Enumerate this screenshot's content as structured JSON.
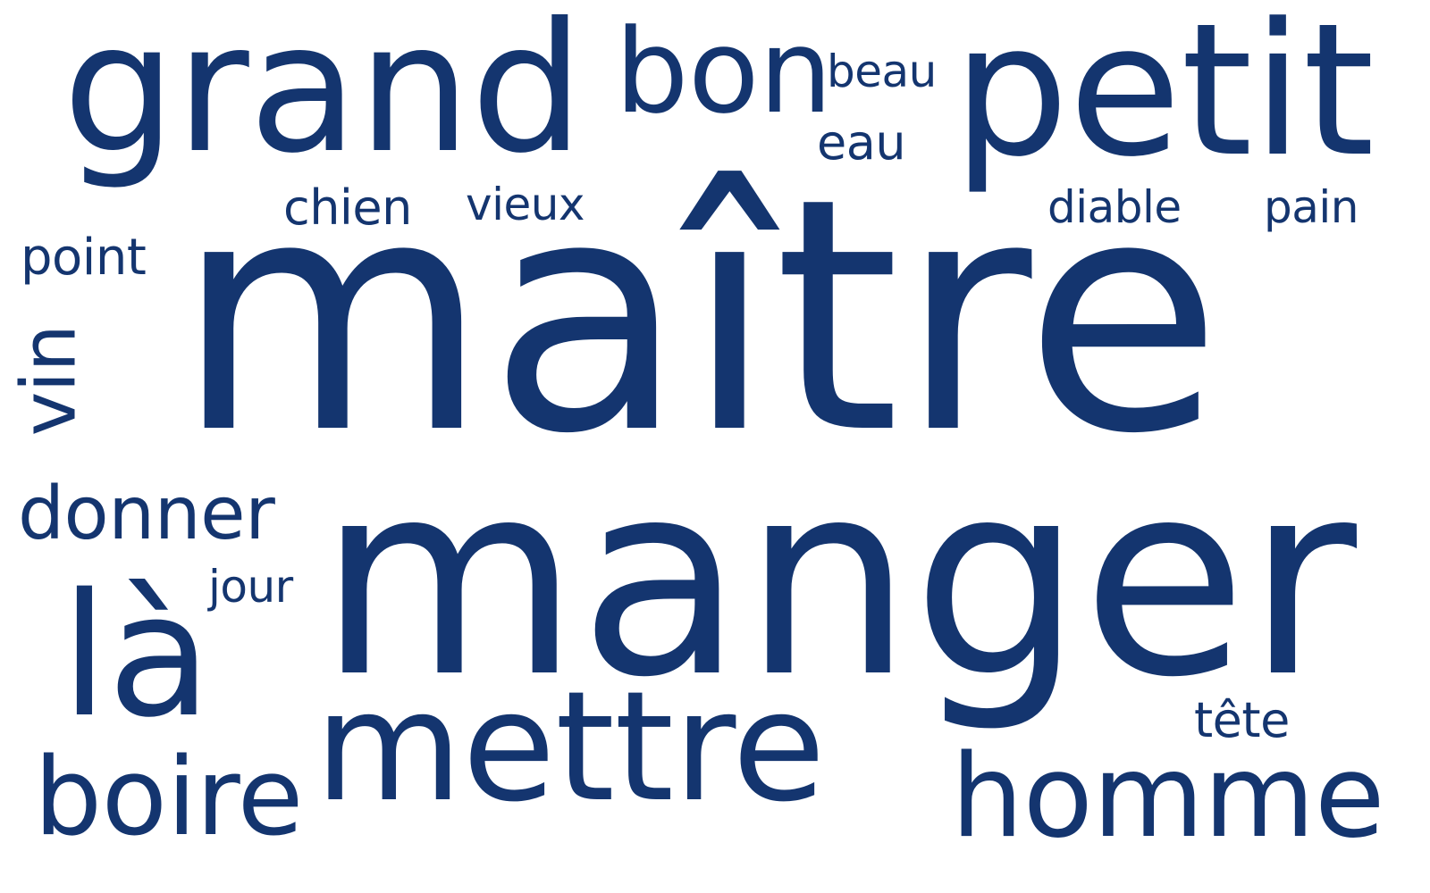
{
  "style": {
    "background": "#ffffff",
    "text_color": "#14356f"
  },
  "words": {
    "maitre": "maître",
    "manger": "manger",
    "grand": "grand",
    "petit": "petit",
    "bon": "bon",
    "beau": "beau",
    "eau": "eau",
    "chien": "chien",
    "vieux": "vieux",
    "diable": "diable",
    "pain": "pain",
    "point": "point",
    "vin": "vin",
    "donner": "donner",
    "jour": "jour",
    "la": "là",
    "mettre": "mettre",
    "boire": "boire",
    "homme": "homme",
    "tete": "tête"
  }
}
